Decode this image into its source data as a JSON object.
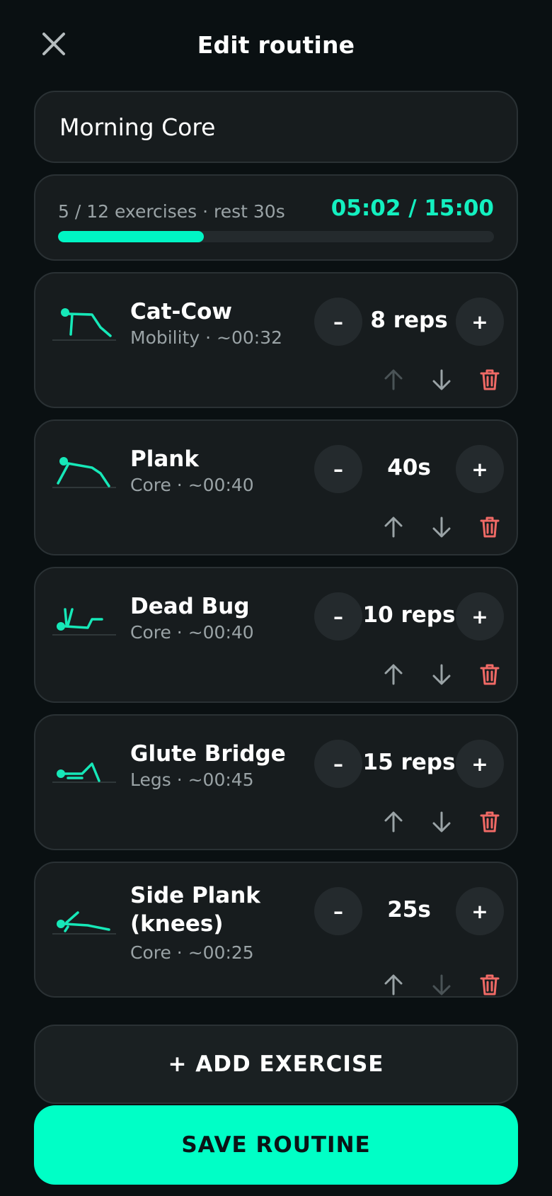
{
  "header": {
    "title": "Edit routine",
    "close_icon": "close-icon"
  },
  "routine": {
    "name": "Morning Core"
  },
  "summary": {
    "text": "5 / 12 exercises · rest 30s",
    "time": "05:02 / 15:00",
    "progress_fraction": 0.335
  },
  "exercises": [
    {
      "name": "Cat-Cow",
      "meta": "Mobility · ~00:32",
      "value": "8 reps",
      "up_enabled": false,
      "down_enabled": true
    },
    {
      "name": "Plank",
      "meta": "Core · ~00:40",
      "value": "40s",
      "up_enabled": true,
      "down_enabled": true
    },
    {
      "name": "Dead Bug",
      "meta": "Core · ~00:40",
      "value": "10 reps",
      "up_enabled": true,
      "down_enabled": true
    },
    {
      "name": "Glute Bridge",
      "meta": "Legs · ~00:45",
      "value": "15 reps",
      "up_enabled": true,
      "down_enabled": true
    },
    {
      "name": "Side Plank (knees)",
      "meta": "Core · ~00:25",
      "value": "25s",
      "up_enabled": true,
      "down_enabled": false
    }
  ],
  "controls": {
    "minus": "–",
    "plus": "+"
  },
  "actions": {
    "add_label": "+ ADD EXERCISE",
    "save_label": "SAVE ROUTINE"
  },
  "colors": {
    "accent": "#00ffc6",
    "delete": "#f06a66",
    "enabled_arrow": "#9aa3a6",
    "disabled_arrow": "#4a5356"
  },
  "icons": [
    "close-icon",
    "arrow-up-icon",
    "arrow-down-icon",
    "trash-icon",
    "exercise-pose-icon"
  ]
}
